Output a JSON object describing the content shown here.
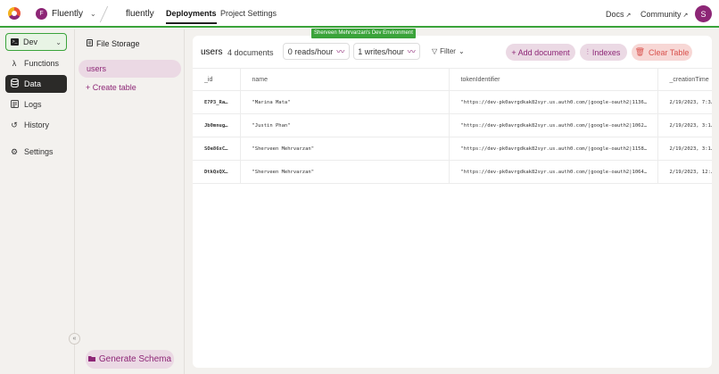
{
  "header": {
    "team_initial": "F",
    "team_name": "Fluently",
    "project_name": "fluently",
    "tabs": [
      "Deployments",
      "Project Settings"
    ],
    "env_badge": "Sherveen Mehrvarzan's Dev Environment",
    "docs": "Docs",
    "community": "Community",
    "user_initial": "S"
  },
  "sidebar": {
    "deployment": "Dev",
    "items": [
      {
        "label": "Functions",
        "icon": "lambda-icon"
      },
      {
        "label": "Data",
        "icon": "database-icon"
      },
      {
        "label": "Logs",
        "icon": "logs-icon"
      },
      {
        "label": "History",
        "icon": "history-icon"
      },
      {
        "label": "Settings",
        "icon": "gear-icon"
      }
    ]
  },
  "tables_panel": {
    "file_storage": "File Storage",
    "tables": [
      "users"
    ],
    "create_table": "+ Create table",
    "generate_schema": "Generate Schema"
  },
  "main": {
    "table_name": "users",
    "doc_count": "4 documents",
    "reads": "0 reads/hour",
    "writes": "1 writes/hour",
    "filter": "Filter",
    "add_document": "+ Add document",
    "indexes": "Indexes",
    "clear_table": "Clear Table",
    "columns": [
      "_id",
      "name",
      "tokenIdentifier",
      "_creationTime"
    ],
    "rows": [
      [
        "E7P3_Ra…",
        "\"Marina Mata\"",
        "\"https://dev-pk0avrgdkak82syr.us.auth0.com/|google-oauth2|1136…",
        "2/19/2023, 7:3…"
      ],
      [
        "Jb0mnug…",
        "\"Justin Phan\"",
        "\"https://dev-pk0avrgdkak82syr.us.auth0.com/|google-oauth2|1062…",
        "2/19/2023, 3:1…"
      ],
      [
        "SOe86xC…",
        "\"Sherveen Mehrvarzan\"",
        "\"https://dev-pk0avrgdkak82syr.us.auth0.com/|google-oauth2|1158…",
        "2/19/2023, 3:1…"
      ],
      [
        "DtkQxQX…",
        "\"Sherveen Mehrvarzan\"",
        "\"https://dev-pk0avrgdkak82syr.us.auth0.com/|google-oauth2|1064…",
        "2/19/2023, 12:…"
      ]
    ]
  },
  "colors": {
    "accent": "#8d2676",
    "env_green": "#3aa33a",
    "danger": "#d9524d"
  }
}
